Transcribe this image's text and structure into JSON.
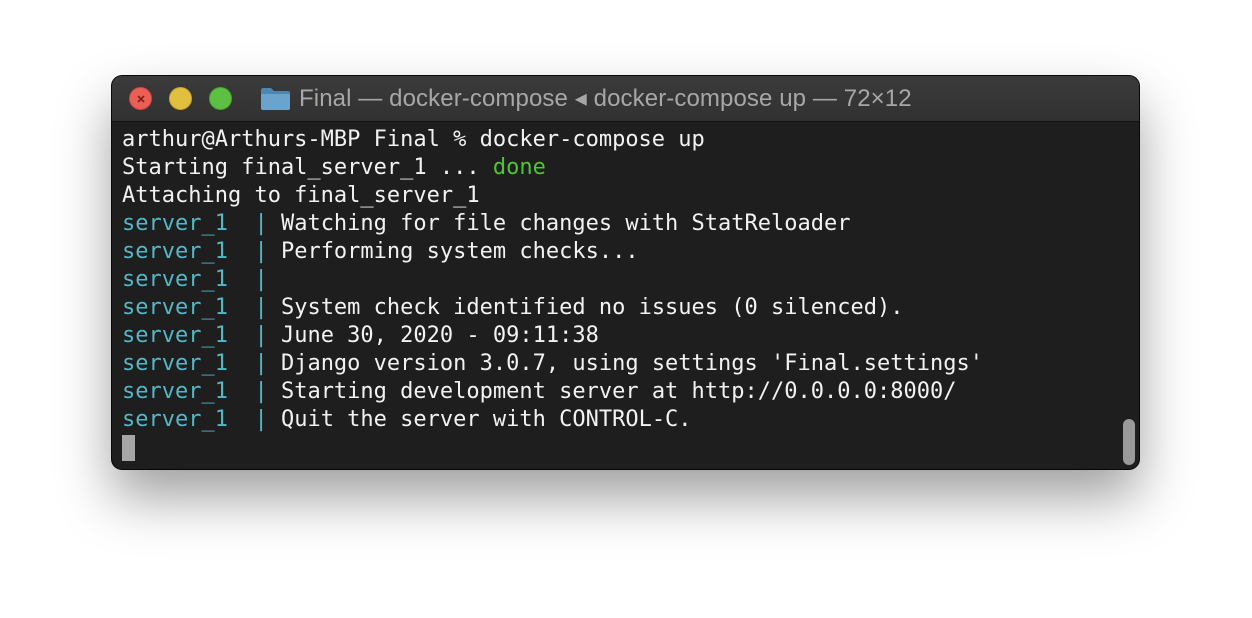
{
  "window": {
    "title": "Final — docker-compose ◂ docker-compose up — 72×12"
  },
  "terminal": {
    "prompt": "arthur@Arthurs-MBP Final % docker-compose up",
    "starting_prefix": "Starting final_server_1 ... ",
    "starting_status": "done",
    "attaching": "Attaching to final_server_1",
    "service_prefix": "server_1  | ",
    "log_lines": [
      "Watching for file changes with StatReloader",
      "Performing system checks...",
      "",
      "System check identified no issues (0 silenced).",
      "June 30, 2020 - 09:11:38",
      "Django version 3.0.7, using settings 'Final.settings'",
      "Starting development server at http://0.0.0.0:8000/",
      "Quit the server with CONTROL-C."
    ]
  },
  "colors": {
    "background": "#1e1e1e",
    "text": "#f2f2f2",
    "done_green": "#4fc534",
    "service_cyan": "#52b8c8"
  }
}
